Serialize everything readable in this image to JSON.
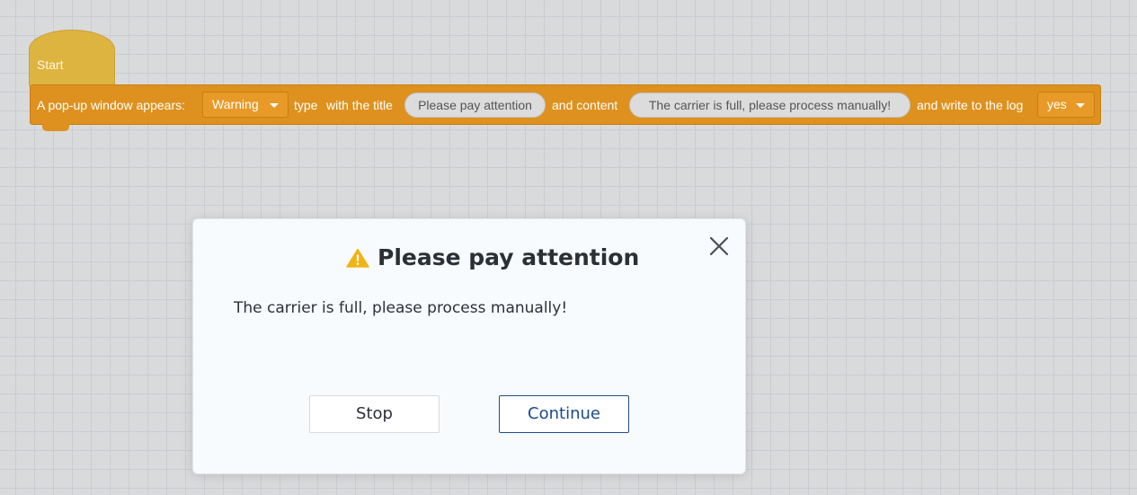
{
  "canvas": {
    "start_block": {
      "label": "Start"
    },
    "command_block": {
      "prefix": "A pop-up window appears:",
      "type_dropdown": "Warning",
      "type_label": "type",
      "title_label": "with the title",
      "title_value": "Please pay attention",
      "content_label": "and content",
      "content_value": "The carrier is full, please process manually!",
      "log_label": "and write to the log",
      "log_dropdown": "yes"
    }
  },
  "dialog": {
    "icon": "warning-triangle-icon",
    "title": "Please pay attention",
    "message": "The carrier is full, please process manually!",
    "stop_label": "Stop",
    "continue_label": "Continue",
    "close_icon": "close-icon"
  },
  "colors": {
    "block_orange": "#de911e",
    "hat_yellow": "#ddb440",
    "warning": "#f2b316",
    "primary_button": "#1a4b8f"
  }
}
